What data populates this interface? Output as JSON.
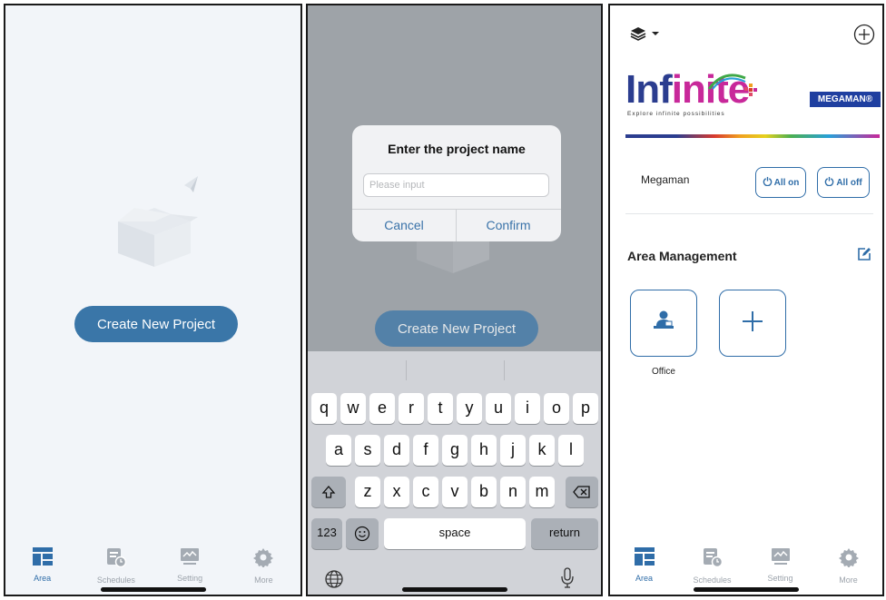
{
  "nav": {
    "items": [
      {
        "label": "Area",
        "icon": "area-grid-icon"
      },
      {
        "label": "Schedules",
        "icon": "schedule-clock-icon"
      },
      {
        "label": "Setting",
        "icon": "monitor-wave-icon"
      },
      {
        "label": "More",
        "icon": "gear-icon"
      }
    ]
  },
  "panel1": {
    "create_button": "Create New Project"
  },
  "panel2": {
    "dialog": {
      "title": "Enter the project name",
      "placeholder": "Please input",
      "cancel": "Cancel",
      "confirm": "Confirm"
    },
    "create_button": "Create New Project",
    "keyboard": {
      "row1": [
        "q",
        "w",
        "e",
        "r",
        "t",
        "y",
        "u",
        "i",
        "o",
        "p"
      ],
      "row2": [
        "a",
        "s",
        "d",
        "f",
        "g",
        "h",
        "j",
        "k",
        "l"
      ],
      "row3": [
        "z",
        "x",
        "c",
        "v",
        "b",
        "n",
        "m"
      ],
      "numbers_key": "123",
      "space_key": "space",
      "return_key": "return"
    }
  },
  "panel3": {
    "logo": {
      "part1": "Inf",
      "part2": "inite",
      "tagline": "Explore infinite possibilities"
    },
    "brand_badge": "MEGAMAN®",
    "group_name": "Megaman",
    "all_on": "All on",
    "all_off": "All off",
    "section_title": "Area Management",
    "areas": [
      {
        "label": "Office"
      }
    ]
  },
  "colors": {
    "accent": "#2f6da8",
    "button": "#3a76a8"
  }
}
